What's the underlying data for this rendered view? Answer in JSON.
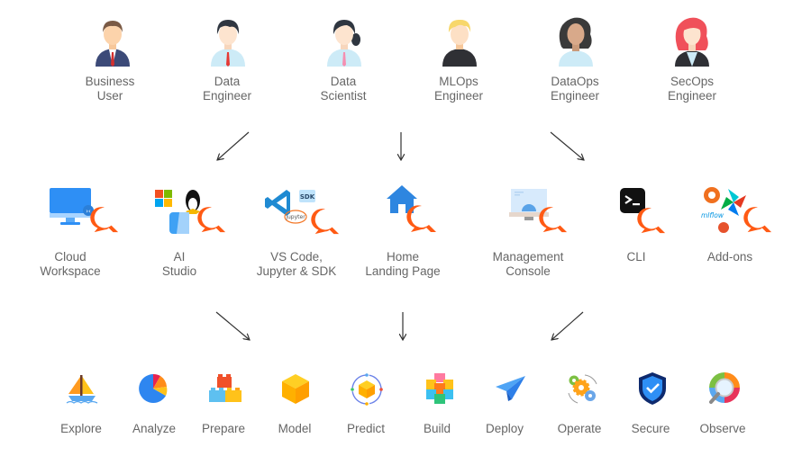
{
  "personas": [
    {
      "id": "business-user",
      "line1": "Business",
      "line2": "User",
      "colors": {
        "hair": "#7a5a45",
        "suit": "#3c4a78",
        "shirt": "#ffffff",
        "tie": "#d32f2f"
      }
    },
    {
      "id": "data-engineer",
      "line1": "Data",
      "line2": "Engineer",
      "colors": {
        "hair": "#2f3640",
        "suit": "#cdebf7",
        "shirt": "#cdebf7",
        "tie": "#e53935"
      }
    },
    {
      "id": "data-scientist",
      "line1": "Data",
      "line2": "Scientist",
      "colors": {
        "hair": "#2f3640",
        "suit": "#cdebf7",
        "shirt": "#cdebf7",
        "tie": "#f48fb1"
      }
    },
    {
      "id": "mlops-engineer",
      "line1": "MLOps",
      "line2": "Engineer",
      "colors": {
        "hair": "#f7d76b",
        "suit": "#2f3035",
        "shirt": "#2f3035",
        "tie": "#2f3035"
      }
    },
    {
      "id": "dataops-engineer",
      "line1": "DataOps",
      "line2": "Engineer",
      "colors": {
        "hair": "#3a3a3a",
        "suit": "#cdebf7",
        "shirt": "#cdebf7",
        "tie": "#cdebf7"
      }
    },
    {
      "id": "secops-engineer",
      "line1": "SecOps",
      "line2": "Engineer",
      "colors": {
        "hair": "#f0505a",
        "suit": "#2f3035",
        "shirt": "#cdebf7",
        "tie": "#cdebf7"
      }
    }
  ],
  "interfaces": [
    {
      "id": "cloud-workspace",
      "icon": "monitor-icon",
      "line1": "Cloud",
      "line2": "Workspace"
    },
    {
      "id": "ai-studio",
      "icon": "os-logos-icon",
      "line1": "AI",
      "line2": "Studio"
    },
    {
      "id": "vscode-jupyter-sdk",
      "icon": "vscode-jupyter-sdk-icon",
      "line1": "VS Code,",
      "line2": "Jupyter & SDK"
    },
    {
      "id": "home-landing-page",
      "icon": "home-icon",
      "line1": "Home",
      "line2": "Landing Page"
    },
    {
      "id": "management-console",
      "icon": "console-gear-icon",
      "line1": "Management",
      "line2": "Console"
    },
    {
      "id": "cli",
      "icon": "terminal-icon",
      "line1": "CLI",
      "line2": ""
    },
    {
      "id": "add-ons",
      "icon": "addons-icon",
      "line1": "Add-ons",
      "line2": ""
    }
  ],
  "capabilities": [
    {
      "id": "explore",
      "icon": "sailboat-icon",
      "label": "Explore"
    },
    {
      "id": "analyze",
      "icon": "pie-chart-icon",
      "label": "Analyze"
    },
    {
      "id": "prepare",
      "icon": "bricks-icon",
      "label": "Prepare"
    },
    {
      "id": "model",
      "icon": "cube-icon",
      "label": "Model"
    },
    {
      "id": "predict",
      "icon": "orbit-cube-icon",
      "label": "Predict"
    },
    {
      "id": "build",
      "icon": "cubes-icon",
      "label": "Build"
    },
    {
      "id": "deploy",
      "icon": "paper-plane-icon",
      "label": "Deploy"
    },
    {
      "id": "operate",
      "icon": "gears-icon",
      "label": "Operate"
    },
    {
      "id": "secure",
      "icon": "shield-check-icon",
      "label": "Secure"
    },
    {
      "id": "observe",
      "icon": "magnifier-icon",
      "label": "Observe"
    }
  ],
  "badges": {
    "vscode_sdk": "SDK",
    "jupyter": "jupyter",
    "mlflow": "mlflow"
  },
  "colors": {
    "brand_orange": "#ff5a14",
    "text": "#666666",
    "arrow": "#333333"
  }
}
